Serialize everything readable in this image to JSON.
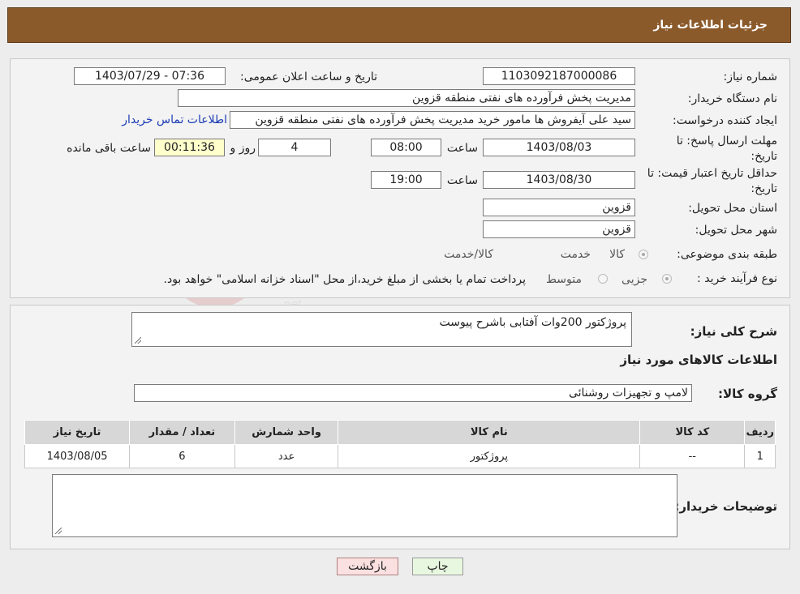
{
  "header": {
    "title": "جزئیات اطلاعات نیاز"
  },
  "form": {
    "need_number_label": "شماره نیاز:",
    "need_number": "1103092187000086",
    "announce_label": "تاریخ و ساعت اعلان عمومی:",
    "announce_value": "1403/07/29 - 07:36",
    "buyer_org_label": "نام دستگاه خریدار:",
    "buyer_org": "مدیریت پخش فرآورده های نفتی منطقه قزوین",
    "creator_label": "ایجاد کننده درخواست:",
    "creator": "سید علی  آیفروش ها مامور خرید مدیریت پخش فرآورده های نفتی منطقه قزوین",
    "contact_link": "اطلاعات تماس خریدار",
    "reply_deadline_label": "مهلت ارسال پاسخ: تا تاریخ:",
    "reply_date": "1403/08/03",
    "time_label": "ساعت",
    "reply_time": "08:00",
    "days_value": "4",
    "days_label": "روز و",
    "remaining_time": "00:11:36",
    "remaining_label": "ساعت باقی مانده",
    "validity_label": "حداقل تاریخ اعتبار قیمت: تا تاریخ:",
    "validity_date": "1403/08/30",
    "validity_time": "19:00",
    "province_label": "استان محل تحویل:",
    "province": "قزوین",
    "city_label": "شهر محل تحویل:",
    "city": "قزوین",
    "category_label": "طبقه بندی موضوعی:",
    "category_options": [
      "کالا",
      "خدمت",
      "کالا/خدمت"
    ],
    "process_label": "نوع فرآیند خرید :",
    "process_options": [
      "جزیی",
      "متوسط"
    ],
    "process_note": "پرداخت تمام یا بخشی از مبلغ خرید،از محل \"اسناد خزانه اسلامی\" خواهد بود."
  },
  "details": {
    "summary_label": "شرح کلی نیاز:",
    "summary": "پروژکتور 200وات آفتابی باشرح پیوست",
    "goods_info_title": "اطلاعات کالاهای مورد نیاز",
    "group_label": "گروه کالا:",
    "group_value": "لامپ و تجهیزات روشنائی",
    "table": {
      "headers": [
        "ردیف",
        "کد کالا",
        "نام کالا",
        "واحد شمارش",
        "تعداد / مقدار",
        "تاریخ نیاز"
      ],
      "rows": [
        [
          "1",
          "--",
          "پروژکتور",
          "عدد",
          "6",
          "1403/08/05"
        ]
      ]
    },
    "buyer_notes_label": "توضیحات خریدار:",
    "buyer_notes": ""
  },
  "buttons": {
    "print": "چاپ",
    "back": "بازگشت"
  },
  "colors": {
    "header": "#8b5a2b",
    "print_btn": "#e8f8e0",
    "back_btn": "#fbe0e0"
  }
}
